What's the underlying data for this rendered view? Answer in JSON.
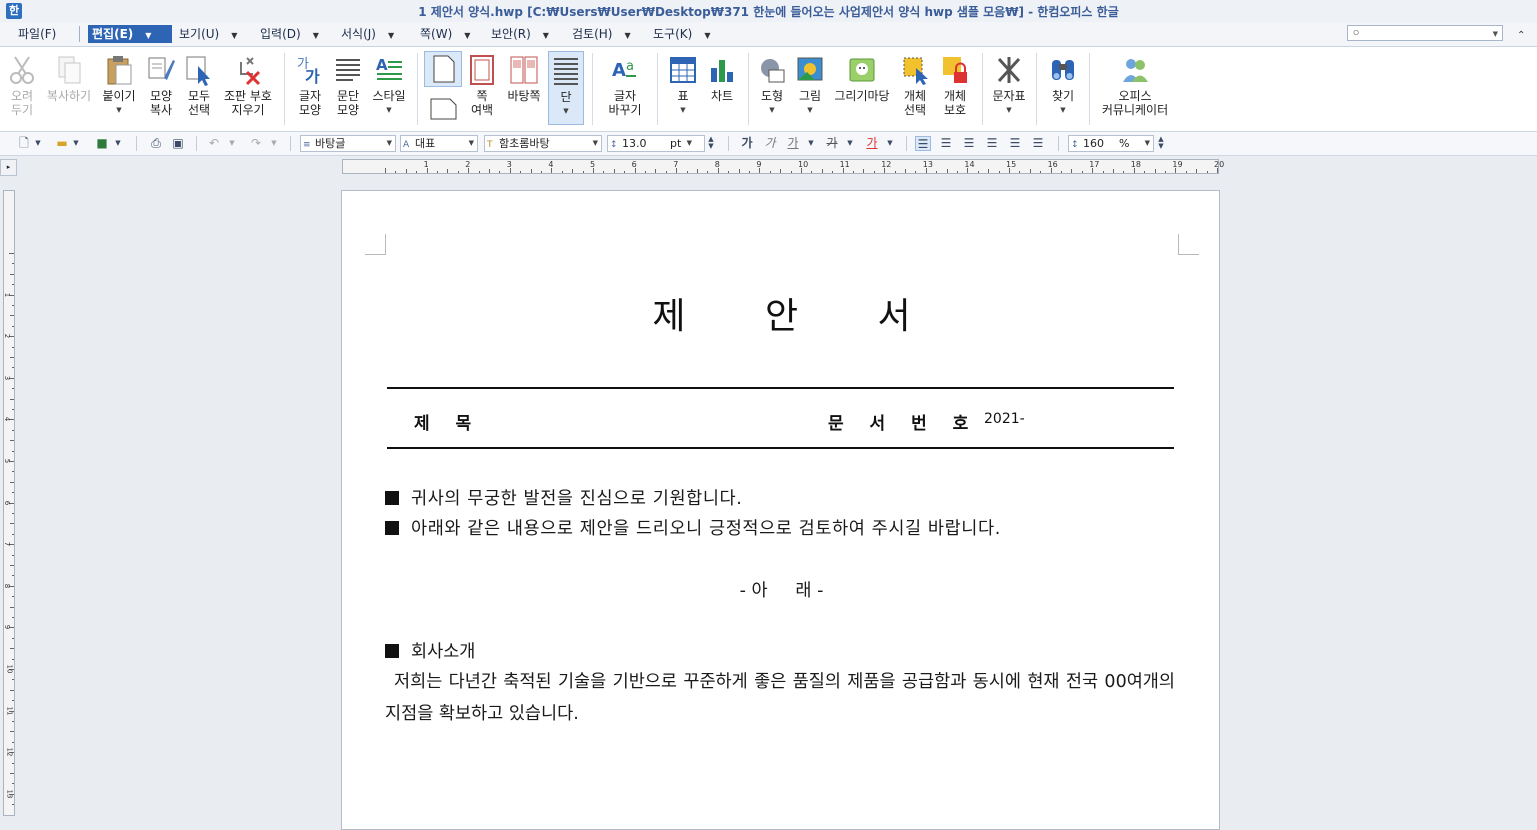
{
  "window": {
    "title": "1 제안서 양식.hwp [C:₩Users₩User₩Desktop₩371 한눈에 들어오는 사업제안서 양식 hwp 샘플 모음₩] - 한컴오피스 한글"
  },
  "menu": {
    "items": [
      "파일(F)",
      "편집(E)",
      "보기(U)",
      "입력(D)",
      "서식(J)",
      "쪽(W)",
      "보안(R)",
      "검토(H)",
      "도구(K)"
    ],
    "active": "편집(E)",
    "search_value": "ㅇ"
  },
  "ribbon": {
    "cut": "오려\n두기",
    "copy": "복사하기",
    "paste": "붙이기",
    "format_copy": "모양\n복사",
    "select_all": "모두\n선택",
    "clear_marks": "조판 부호\n지우기",
    "char_shape": "글자\n모양",
    "para_shape": "문단\n모양",
    "style": "스타일",
    "page_margin": "쪽\n여백",
    "background_page": "바탕쪽",
    "column": "단",
    "char_replace": "글자\n바꾸기",
    "table": "표",
    "chart": "차트",
    "shape": "도형",
    "picture": "그림",
    "drawing_board": "그리기마당",
    "object_select": "개체\n선택",
    "object_protect": "개체\n보호",
    "char_map": "문자표",
    "find": "찾기",
    "office_communicator": "오피스\n커뮤니케이터"
  },
  "format_bar": {
    "style": "바탕글",
    "lang": "대표",
    "font": "함초롬바탕",
    "size": "13.0",
    "size_unit": "pt",
    "bold": "가",
    "italic": "가",
    "underline": "가",
    "strike": "가",
    "color": "가",
    "line_spacing": "160",
    "line_spacing_unit": "%"
  },
  "ruler": {
    "numbers": [
      "1",
      "2",
      "3",
      "4",
      "5",
      "6",
      "7",
      "8",
      "9",
      "10",
      "11",
      "12",
      "13",
      "14",
      "15",
      "16",
      "17",
      "18",
      "19",
      "20"
    ],
    "v_numbers": [
      "1",
      "2",
      "3",
      "4",
      "5",
      "6",
      "7",
      "8",
      "9",
      "10",
      "11",
      "12",
      "13"
    ]
  },
  "document": {
    "title": "제  안  서",
    "field_subject_label": "제    목",
    "field_docnum_label": "문 서 번 호",
    "field_docnum_value": "2021-",
    "line1": "귀사의 무궁한 발전을 진심으로 기원합니다.",
    "line2": "아래와 같은 내용으로 제안을 드리오니 긍정적으로 검토하여 주시길 바랍니다.",
    "below": "- 아     래 -",
    "section1": "회사소개",
    "section1_body": "저희는 다년간 축적된 기술을 기반으로 꾸준하게 좋은 품질의 제품을 공급함과 동시에 현재 전국 00여개의 지점을 확보하고 있습니다."
  }
}
